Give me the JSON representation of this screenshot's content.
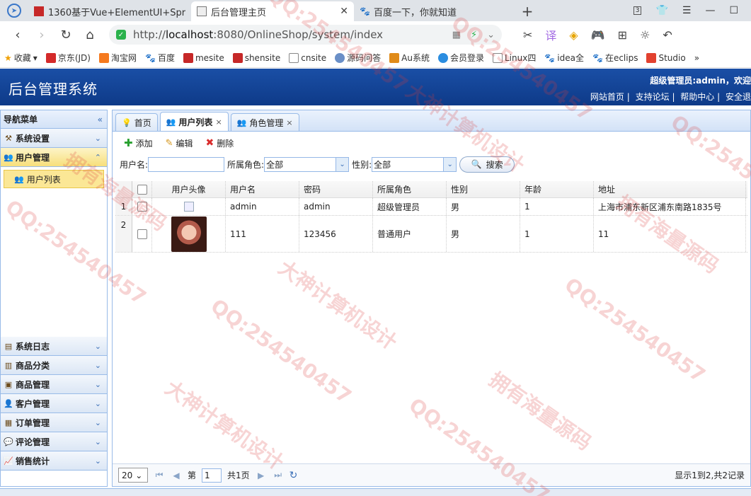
{
  "browser": {
    "tabs": [
      {
        "title": "1360基于Vue+ElementUI+Spr",
        "active": false
      },
      {
        "title": "后台管理主页",
        "active": true
      },
      {
        "title": "百度一下，你就知道",
        "active": false
      }
    ],
    "tab_count_badge": "3",
    "url_prefix": "http://",
    "url_host": "localhost",
    "url_rest": ":8080/OnlineShop/system/index"
  },
  "bookmarks": [
    "收藏",
    "京东(JD)",
    "淘宝网",
    "百度",
    "mesite",
    "shensite",
    "cnsite",
    "源码问答",
    "Au系统",
    "会员登录",
    "Linux四",
    "idea全",
    "在eclips",
    "Studio"
  ],
  "app": {
    "title": "后台管理系统",
    "user_greeting": "超级管理员:admin，欢迎",
    "links": [
      "网站首页",
      "支持论坛",
      "帮助中心",
      "安全退"
    ]
  },
  "nav": {
    "header": "导航菜单",
    "sections_top": [
      {
        "label": "系统设置",
        "active": false
      },
      {
        "label": "用户管理",
        "active": true
      }
    ],
    "active_item": "用户列表",
    "sections_bottom": [
      "系统日志",
      "商品分类",
      "商品管理",
      "客户管理",
      "订单管理",
      "评论管理",
      "销售统计"
    ]
  },
  "main": {
    "tabs": [
      {
        "label": "首页",
        "closable": false,
        "active": false
      },
      {
        "label": "用户列表",
        "closable": true,
        "active": true
      },
      {
        "label": "角色管理",
        "closable": true,
        "active": false
      }
    ],
    "toolbar": {
      "add": "添加",
      "edit": "编辑",
      "delete": "删除"
    },
    "filter": {
      "username_label": "用户名:",
      "username_value": "",
      "role_label": "所属角色:",
      "role_value": "全部",
      "sex_label": "性别:",
      "sex_value": "全部",
      "search": "搜索"
    },
    "grid": {
      "columns": [
        "用户头像",
        "用户名",
        "密码",
        "所属角色",
        "性别",
        "年龄",
        "地址"
      ],
      "rows": [
        {
          "num": "1",
          "username": "admin",
          "password": "admin",
          "role": "超级管理员",
          "sex": "男",
          "age": "1",
          "address": "上海市浦东新区浦东南路1835号"
        },
        {
          "num": "2",
          "username": "111",
          "password": "123456",
          "role": "普通用户",
          "sex": "男",
          "age": "1",
          "address": "11"
        }
      ]
    },
    "pager": {
      "page_size": "20",
      "page_prefix": "第",
      "page_value": "1",
      "page_suffix": "共1页",
      "info": "显示1到2,共2记录"
    }
  },
  "watermarks": [
    "QQ:254540457",
    "大神计算机设计",
    "拥有海量源码"
  ]
}
